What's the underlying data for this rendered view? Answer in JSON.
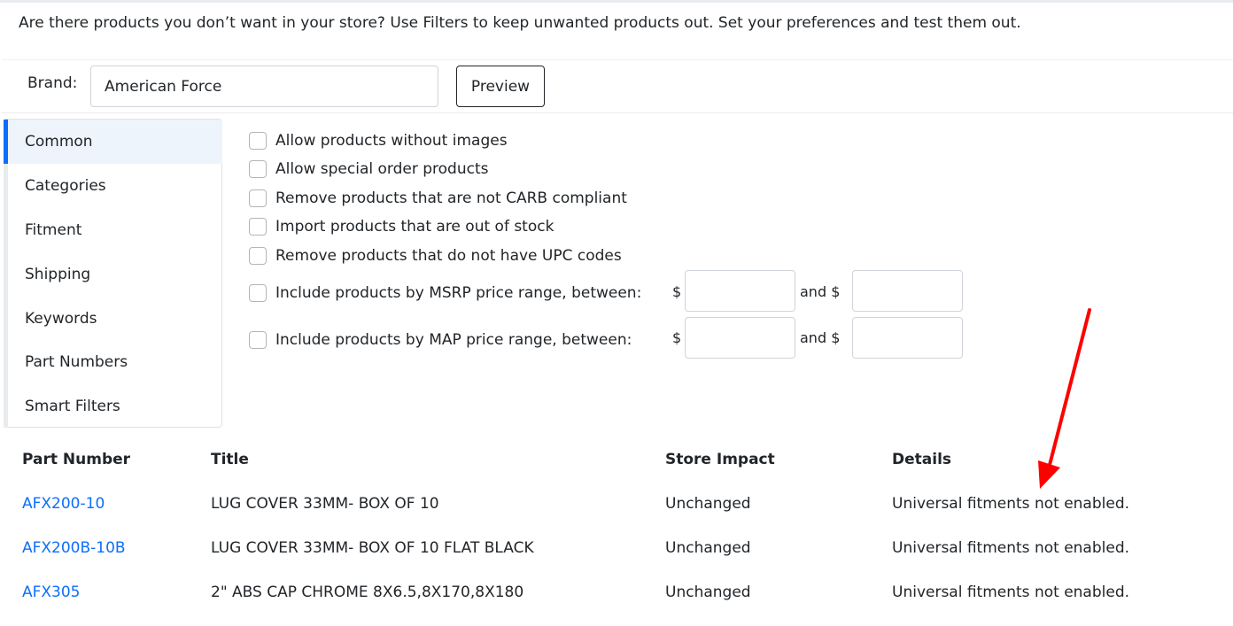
{
  "intro_text": "Are there products you don’t want in your store? Use Filters to keep unwanted products out. Set your preferences and test them out.",
  "brand": {
    "label": "Brand:",
    "value": "American Force"
  },
  "preview_label": "Preview",
  "sidebar": {
    "items": [
      {
        "label": "Common",
        "active": true
      },
      {
        "label": "Categories"
      },
      {
        "label": "Fitment"
      },
      {
        "label": "Shipping"
      },
      {
        "label": "Keywords"
      },
      {
        "label": "Part Numbers"
      },
      {
        "label": "Smart Filters"
      }
    ]
  },
  "options": [
    {
      "label": "Allow products without images",
      "checked": false
    },
    {
      "label": "Allow special order products",
      "checked": false
    },
    {
      "label": "Remove products that are not CARB compliant",
      "checked": false
    },
    {
      "label": "Import products that are out of stock",
      "checked": false
    },
    {
      "label": "Remove products that do not have UPC codes",
      "checked": false
    },
    {
      "label": "Include products by MSRP price range, between:",
      "checked": false
    },
    {
      "label": "Include products by MAP price range, between:",
      "checked": false
    }
  ],
  "price_range": {
    "currency": "$",
    "and_label": "and $",
    "msrp_min": "",
    "msrp_max": "",
    "map_min": "",
    "map_max": ""
  },
  "table": {
    "headers": [
      "Part Number",
      "Title",
      "Store Impact",
      "Details"
    ],
    "rows": [
      [
        "AFX200-10",
        "LUG COVER 33MM- BOX OF 10",
        "Unchanged",
        "Universal fitments not enabled."
      ],
      [
        "AFX200B-10B",
        "LUG COVER 33MM- BOX OF 10 FLAT BLACK",
        "Unchanged",
        "Universal fitments not enabled."
      ],
      [
        "AFX305",
        "2\" ABS CAP CHROME 8X6.5,8X170,8X180",
        "Unchanged",
        "Universal fitments not enabled."
      ]
    ]
  },
  "colors": {
    "link": "#0d6efd",
    "active_accent": "#0d6efd",
    "annotation_arrow": "#ff0000"
  }
}
